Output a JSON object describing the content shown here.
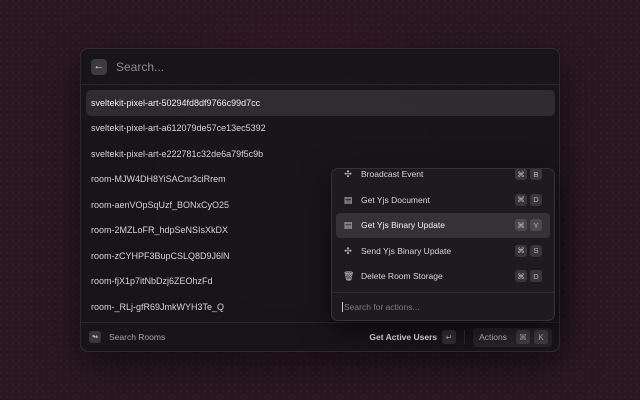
{
  "search": {
    "placeholder": "Search...",
    "back_icon": "arrow-left-icon"
  },
  "rooms": [
    "sveltekit-pixel-art-50294fd8df9766c99d7cc",
    "sveltekit-pixel-art-a612079de57ce13ec5392",
    "sveltekit-pixel-art-e222781c32de6a79f5c9b",
    "room-MJW4DH8YiSACnr3ciRrem",
    "room-aenVOpSqUzf_BONxCyO25",
    "room-2MZLoFR_hdpSeNSIsXkDX",
    "room-zCYHPF3BupCSLQ8D9J6lN",
    "room-fjX1p7itNbDzj6ZEOhzFd",
    "room-_RLj-gfR69JmkWYH3Te_Q"
  ],
  "footer": {
    "title": "Search Rooms",
    "primary_action": "Get Active Users",
    "enter_key": "↵",
    "actions_label": "Actions",
    "actions_keys": [
      "⌘",
      "K"
    ]
  },
  "actions_panel": {
    "items": [
      {
        "label": "Broadcast Event",
        "icon": "broadcast-icon",
        "keys": [
          "⌘",
          "B"
        ]
      },
      {
        "label": "Get Yjs Document",
        "icon": "document-icon",
        "keys": [
          "⌘",
          "D"
        ]
      },
      {
        "label": "Get Yjs Binary Update",
        "icon": "document-icon",
        "keys": [
          "⌘",
          "Y"
        ]
      },
      {
        "label": "Send Yjs Binary Update",
        "icon": "send-icon",
        "keys": [
          "⌘",
          "S"
        ]
      },
      {
        "label": "Delete Room Storage",
        "icon": "trash-icon",
        "keys": [
          "⌘",
          "D"
        ]
      }
    ],
    "search_placeholder": "Search for actions..."
  },
  "icons": {
    "back": "←",
    "logo": "↬",
    "broadcast": "✣",
    "document": "▤",
    "send": "✣",
    "trash": "🗑"
  }
}
